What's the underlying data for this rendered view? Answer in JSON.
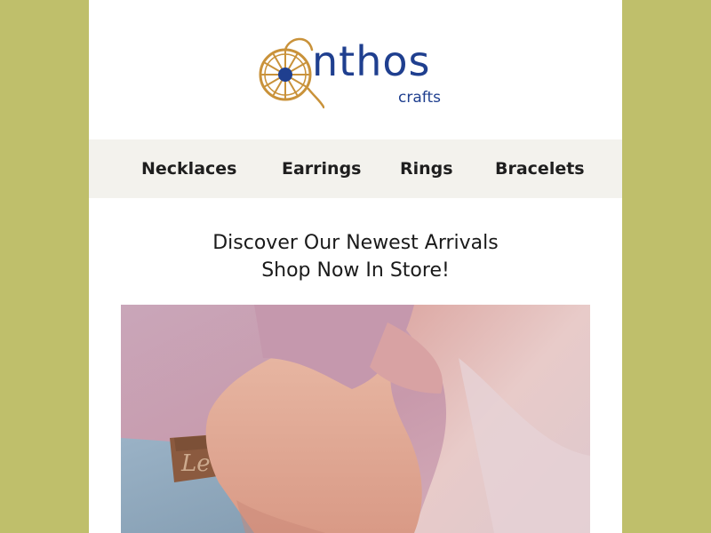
{
  "brand": {
    "name": "nthos",
    "subtitle": "crafts",
    "colors": {
      "primary": "#1f3f8f",
      "logo_ring": "#c9923a",
      "page_bg": "#bfbf6b",
      "nav_bg": "#f3f2ed"
    }
  },
  "nav": {
    "items": [
      {
        "label": "Necklaces"
      },
      {
        "label": "Earrings"
      },
      {
        "label": "Rings"
      },
      {
        "label": "Bracelets"
      }
    ]
  },
  "headline": {
    "line1": "Discover Our Newest Arrivals",
    "line2": "Shop Now In Store!"
  },
  "hero": {
    "patch_text": "Le"
  }
}
